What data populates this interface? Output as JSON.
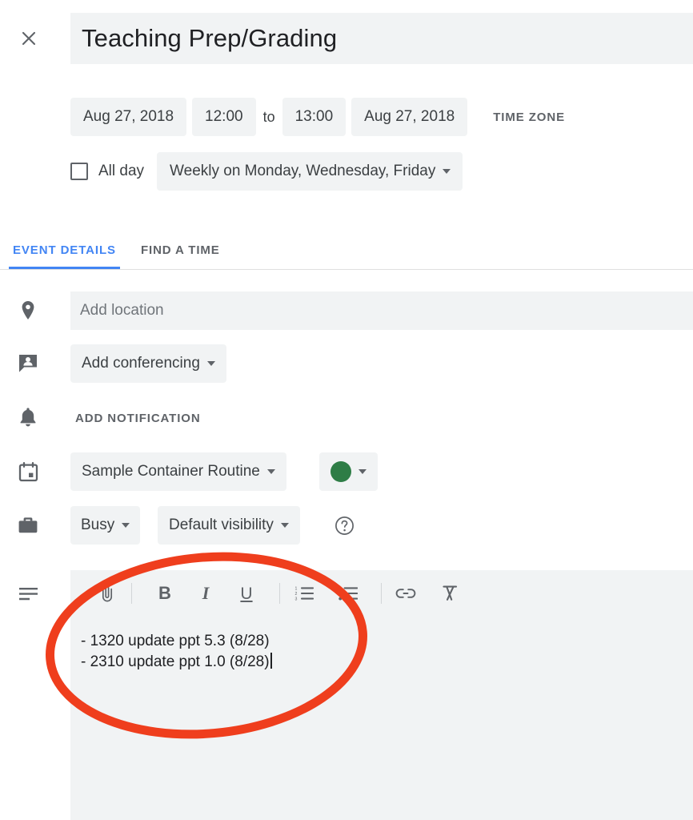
{
  "header": {
    "close_icon": "close-icon",
    "title": "Teaching Prep/Grading"
  },
  "schedule": {
    "start_date": "Aug 27, 2018",
    "start_time": "12:00",
    "separator": "to",
    "end_time": "13:00",
    "end_date": "Aug 27, 2018",
    "time_zone_label": "TIME ZONE",
    "all_day_label": "All day",
    "all_day_checked": false,
    "recurrence": "Weekly on Monday, Wednesday, Friday"
  },
  "tabs": [
    {
      "label": "EVENT DETAILS",
      "active": true
    },
    {
      "label": "FIND A TIME",
      "active": false
    }
  ],
  "details": {
    "location": {
      "icon": "location-pin-icon",
      "placeholder": "Add location",
      "value": ""
    },
    "conferencing": {
      "icon": "conferencing-icon",
      "label": "Add conferencing"
    },
    "notification": {
      "icon": "bell-icon",
      "label": "ADD NOTIFICATION"
    },
    "calendar": {
      "icon": "calendar-icon",
      "label": "Sample Container Routine"
    },
    "color": {
      "label": "",
      "hex": "#2E7D46"
    },
    "availability": {
      "icon": "briefcase-icon",
      "label": "Busy"
    },
    "visibility": {
      "label": "Default visibility"
    },
    "help": {
      "icon": "help-circle-icon"
    }
  },
  "description": {
    "icon": "description-lines-icon",
    "toolbar": [
      {
        "name": "attach-icon",
        "label": "attach"
      },
      {
        "name": "bold-icon",
        "label": "B"
      },
      {
        "name": "italic-icon",
        "label": "I"
      },
      {
        "name": "underline-icon",
        "label": "U"
      },
      {
        "name": "numbered-list-icon",
        "label": "numbered list"
      },
      {
        "name": "bulleted-list-icon",
        "label": "bulleted list"
      },
      {
        "name": "link-icon",
        "label": "link"
      },
      {
        "name": "clear-formatting-icon",
        "label": "clear formatting"
      }
    ],
    "lines": [
      "- 1320 update ppt 5.3 (8/28)",
      "- 2310 update ppt 1.0 (8/28)"
    ],
    "text": "- 1320 update ppt 5.3 (8/28)\n- 2310 update ppt 1.0 (8/28)"
  },
  "annotation": {
    "shape": "ellipse",
    "color": "#EF3E1D",
    "stroke_width": 9
  },
  "colors": {
    "accent_blue": "#4285F4",
    "field_gray": "#F1F3F4",
    "text_primary": "#202124",
    "text_secondary": "#5f6368",
    "calendar_green": "#2E7D46",
    "annotation_red": "#EF3E1D"
  }
}
